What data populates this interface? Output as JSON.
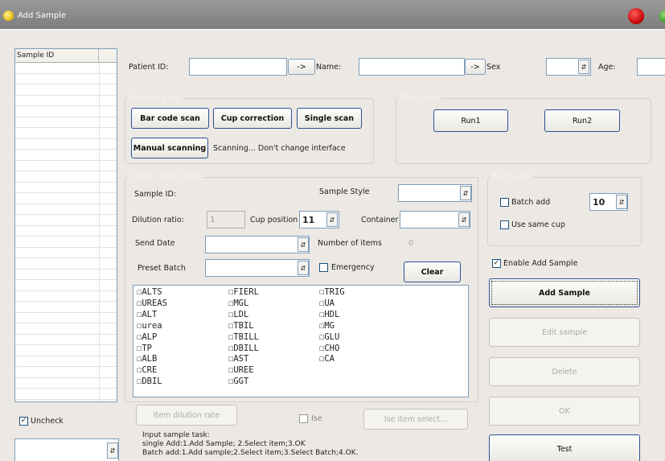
{
  "window": {
    "title": "Add Sample"
  },
  "sample_list": {
    "column_header": "Sample ID",
    "row_count": 32
  },
  "patient": {
    "id_label": "Patient ID:",
    "id_value": "",
    "arrow1": "->",
    "name_label": "Name:",
    "name_value": "",
    "arrow2": "->",
    "sex_label": "Sex",
    "sex_value": "",
    "age_label": "Age:",
    "age_value": ""
  },
  "barcode_group": {
    "title": "Barcode input",
    "bar_code_scan": "Bar code scan",
    "cup_correction": "Cup correction",
    "single_scan": "Single scan",
    "manual_scanning": "Manual scanning",
    "status": "Scanning... Don't change interface"
  },
  "other_task": {
    "title": "Other task",
    "run1": "Run1",
    "run2": "Run2"
  },
  "sample_info": {
    "title": "Sample Infomation",
    "sample_id_label": "Sample ID:",
    "sample_style_label": "Sample Style",
    "sample_style_value": "",
    "dilution_label": "Dilution ratio:",
    "dilution_value": "1",
    "cup_position_label": "Cup position",
    "cup_position_value": "11",
    "container_label": "Container",
    "container_value": "",
    "send_date_label": "Send Date",
    "send_date_value": "",
    "number_items_label": "Number of items",
    "number_items_value": "0",
    "preset_batch_label": "Preset Batch",
    "preset_batch_value": "",
    "emergency_label": "Emergency",
    "clear": "Clear"
  },
  "items": [
    [
      "ALTS",
      "FIERL",
      "TRIG"
    ],
    [
      "UREAS",
      "MGL",
      "UA"
    ],
    [
      "ALT",
      "LDL",
      "HDL"
    ],
    [
      "urea",
      "TBIL",
      "MG"
    ],
    [
      "ALP",
      "TBILL",
      "GLU"
    ],
    [
      "TP",
      "DBILL",
      "CHO"
    ],
    [
      "ALB",
      "AST",
      "CA"
    ],
    [
      "CRE",
      "UREE",
      ""
    ],
    [
      "DBIL",
      "GGT",
      ""
    ]
  ],
  "batch_add": {
    "title": "Batch add",
    "batch_add_label": "Batch add",
    "batch_count": "10",
    "use_same_cup": "Use same cup"
  },
  "enable_add_sample": "Enable Add Sample",
  "actions": {
    "add_sample": "Add Sample",
    "edit_sample": "Edit sample",
    "delete": "Delete",
    "ok": "OK",
    "test": "Test"
  },
  "bottom": {
    "uncheck": "Uncheck",
    "item_dilution_rate": "Item dilution rate",
    "ise": "Ise",
    "ise_item_select": "Ise item select...",
    "hint_title": "Input sample task:",
    "hint_single": "single Add:1.Add Sample; 2.Select item;3.OK",
    "hint_batch": "Batch add:1.Add sample;2.Select item;3.Select Batch;4.OK."
  },
  "colors": {
    "title_bar": "#8a8a8a",
    "window_bg": "#ece9e4",
    "button_border": "#2c5193",
    "close_red": "#c00000"
  }
}
